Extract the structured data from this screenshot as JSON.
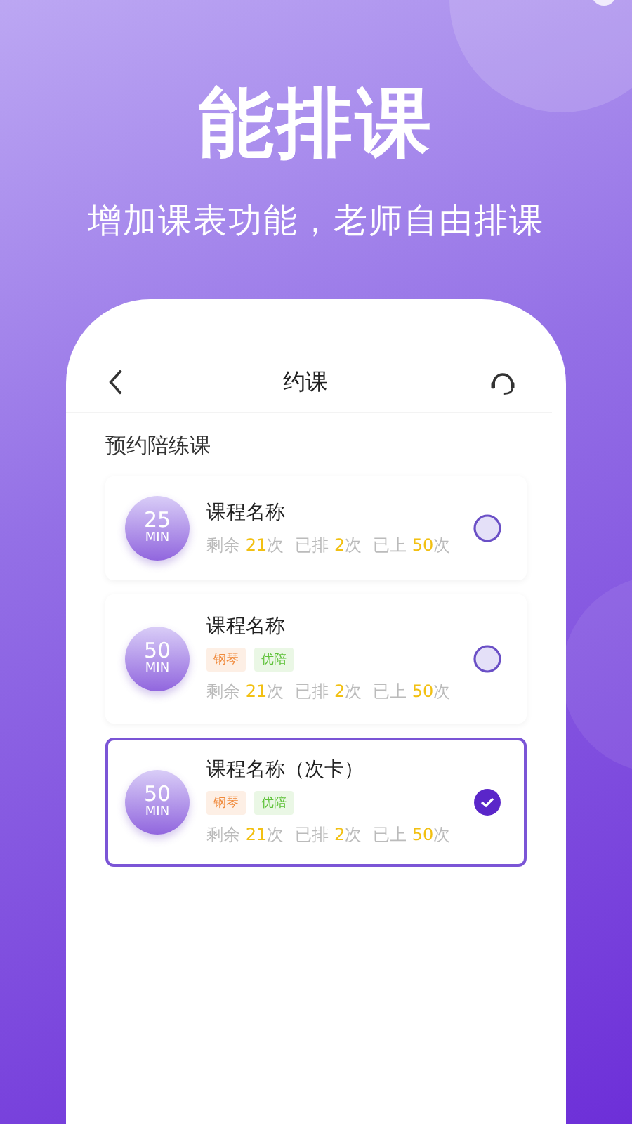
{
  "headline": "能排课",
  "subtitle": "增加课表功能，老师自由排课",
  "nav": {
    "title": "约课"
  },
  "section_title": "预约陪练课",
  "courses": [
    {
      "minutes": "25",
      "unit": "MIN",
      "name": "课程名称",
      "stats": [
        {
          "label": "剩余",
          "value": "21",
          "unit": "次"
        },
        {
          "label": "已排",
          "value": "2",
          "unit": "次"
        },
        {
          "label": "已上",
          "value": "50",
          "unit": "次"
        }
      ],
      "selected": false
    },
    {
      "minutes": "50",
      "unit": "MIN",
      "name": "课程名称",
      "tags": [
        {
          "label": "钢琴",
          "color": "#f08a3c"
        },
        {
          "label": "优陪",
          "color": "#5fc23a"
        }
      ],
      "stats": [
        {
          "label": "剩余",
          "value": "21",
          "unit": "次"
        },
        {
          "label": "已排",
          "value": "2",
          "unit": "次"
        },
        {
          "label": "已上",
          "value": "50",
          "unit": "次"
        }
      ],
      "selected": false
    },
    {
      "minutes": "50",
      "unit": "MIN",
      "name": "课程名称（次卡）",
      "tags": [
        {
          "label": "钢琴",
          "color": "#f08a3c"
        },
        {
          "label": "优陪",
          "color": "#5fc23a"
        }
      ],
      "stats": [
        {
          "label": "剩余",
          "value": "21",
          "unit": "次"
        },
        {
          "label": "已排",
          "value": "2",
          "unit": "次"
        },
        {
          "label": "已上",
          "value": "50",
          "unit": "次"
        }
      ],
      "selected": true
    }
  ]
}
